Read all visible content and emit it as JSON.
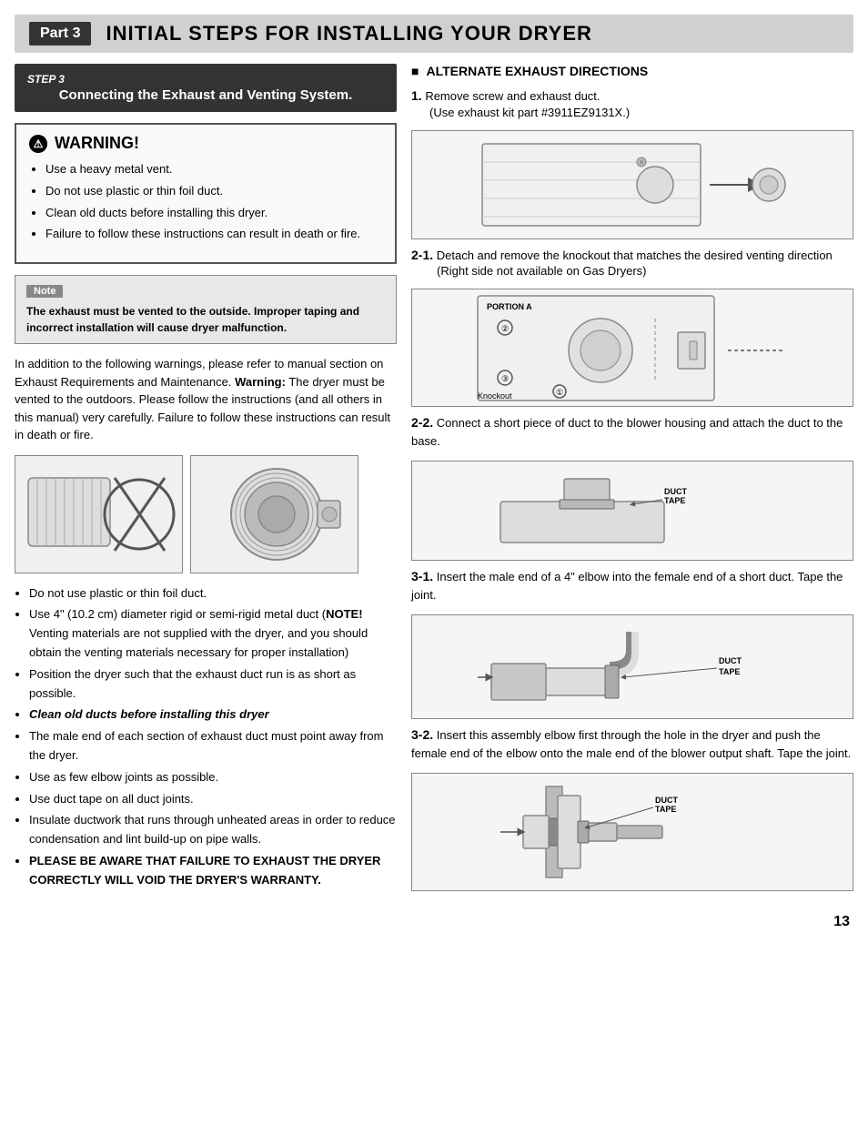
{
  "header": {
    "part_badge": "Part 3",
    "title": "INITIAL STEPS FOR INSTALLING YOUR DRYER"
  },
  "step_box": {
    "step_label": "STEP 3",
    "step_title": "Connecting the Exhaust and Venting System."
  },
  "warning": {
    "title": "WARNING!",
    "icon": "!",
    "items": [
      "Use a heavy metal vent.",
      "Do not use plastic or thin foil duct.",
      "Clean old ducts before installing this dryer.",
      "Failure to follow these instructions can result in death or fire."
    ]
  },
  "note": {
    "label": "Note",
    "text": "The exhaust must be vented to the outside. Improper taping and incorrect installation will cause dryer malfunction."
  },
  "body_text": "In addition to the following warnings, please refer to manual section on Exhaust Requirements and Maintenance. Warning:  The dryer must be vented to the outdoors.  Please follow the  instructions (and all others in this manual) very carefully. Failure to follow these instructions can result in death or fire.",
  "bullet_list": [
    "Do not use plastic or thin foil duct.",
    "Use 4\" (10.2 cm) diameter rigid or semi-rigid metal duct (NOTE! Venting materials are not supplied with the dryer, and you should obtain the venting materials necessary for proper installation)",
    "Position the dryer such that the exhaust duct run is as short as possible.",
    "Clean old ducts before installing this dryer",
    "The male end of each section of exhaust duct must point away from the dryer.",
    "Use as few elbow joints as possible.",
    "Use duct tape on all duct joints.",
    "Insulate ductwork that runs through unheated areas in order to reduce condensation and lint build-up on pipe walls.",
    "PLEASE BE AWARE THAT FAILURE TO EXHAUST THE DRYER CORRECTLY WILL VOID THE DRYER'S WARRANTY."
  ],
  "right_section": {
    "title": "ALTERNATE EXHAUST DIRECTIONS",
    "step1": {
      "num": "1.",
      "text": "Remove screw and exhaust duct.",
      "sub": "(Use exhaust kit part #3911EZ9131X.)"
    },
    "step2_1": {
      "num": "2-1.",
      "text": "Detach and remove the knockout that matches the desired venting direction",
      "sub": "(Right side not available on Gas Dryers)"
    },
    "step2_2": {
      "num": "2-2.",
      "text": "Connect a short piece of duct to the blower housing and attach the duct to the base."
    },
    "step3_1": {
      "num": "3-1.",
      "text": "Insert the male end of a 4\" elbow into the female end of a short duct. Tape the joint."
    },
    "step3_2": {
      "num": "3-2.",
      "text": "Insert this assembly elbow first through the hole in the dryer and push the female end of the elbow onto the male end of the blower output shaft. Tape the joint."
    },
    "duct_tape_label": "DUCT TAPE"
  },
  "page_number": "13"
}
